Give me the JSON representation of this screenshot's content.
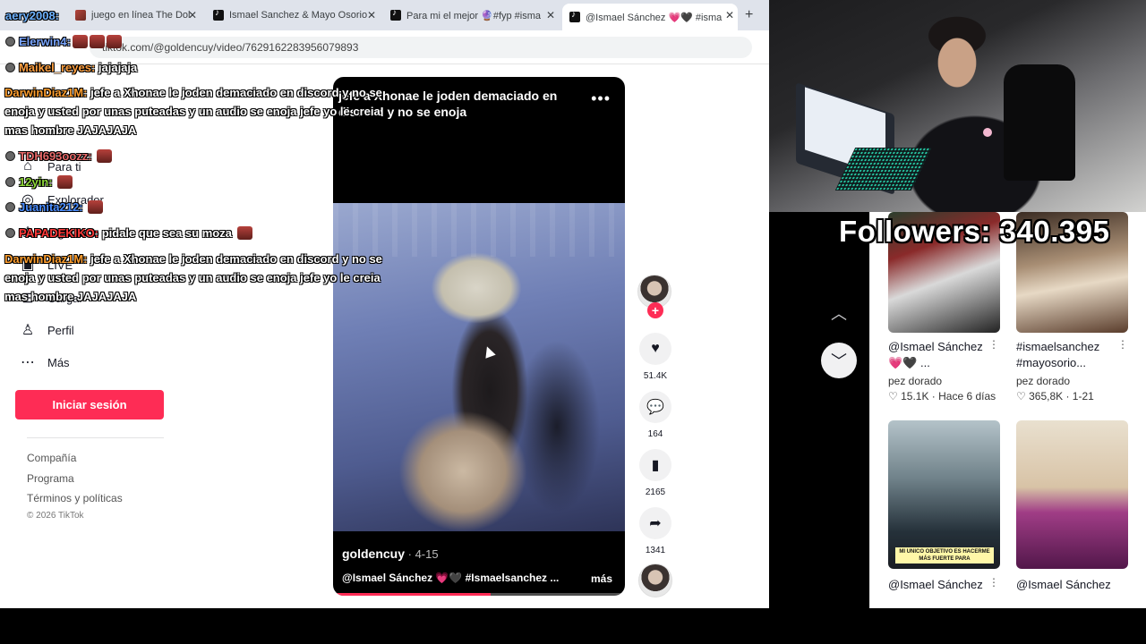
{
  "browser": {
    "tabs": [
      {
        "title": "juego en línea The Dol",
        "icon": "image-favicon"
      },
      {
        "title": "Ismael Sanchez & Mayo Osorio",
        "icon": "tiktok-favicon"
      },
      {
        "title": "Para mi el mejor 🔮#fyp #isma",
        "icon": "tiktok-favicon"
      },
      {
        "title": "@Ismael Sánchez 💗🖤 #isma",
        "icon": "tiktok-favicon",
        "active": true
      }
    ],
    "url": "tiktok.com/@goldencuy/video/7629162283956079893"
  },
  "sidebar": {
    "items": [
      {
        "label": "Para ti",
        "icon": "home-icon"
      },
      {
        "label": "Explorador",
        "icon": "compass-icon"
      },
      {
        "label": "Siguiendo",
        "icon": "following-icon"
      },
      {
        "label": "LIVE",
        "icon": "live-icon"
      },
      {
        "label": "Cargar",
        "icon": "upload-icon"
      },
      {
        "label": "Perfil",
        "icon": "profile-icon"
      },
      {
        "label": "Más",
        "icon": "more-icon"
      }
    ],
    "login": "Iniciar sesión",
    "footer_links": [
      "Compañía",
      "Programa",
      "Términos y políticas"
    ],
    "copyright": "© 2026 TikTok"
  },
  "video": {
    "caption": "jefe a Xhonae le joden demaciado en discord y no se enoja",
    "menu": "•••",
    "author": "goldencuy",
    "date": " · 4-15",
    "description": "@Ismael Sánchez 💗🖤 #Ismaelsanchez ...",
    "more": "más",
    "progress": 0.54
  },
  "actions": {
    "likes": "51.4K",
    "comments": "164",
    "saves": "2165",
    "shares": "1341"
  },
  "recommendations": [
    {
      "title_line1": "@Ismael Sánchez",
      "title_line2": "💗🖤 ...",
      "sub": "pez dorado",
      "meta": "♡ 15.1K · Hace 6 días"
    },
    {
      "title_line1": "#ismaelsanchez",
      "title_line2": "#mayosorio...",
      "sub": "pez dorado",
      "meta": "♡ 365,8K · 1-21"
    },
    {
      "title_line1": "@Ismael Sánchez",
      "thumb_caption": "MI UNICO OBJETIVO ES HACERME MÁS FUERTE PARA"
    },
    {
      "title_line1": "@Ismael Sánchez"
    }
  ],
  "stream": {
    "followers": "Followers: 340.395",
    "chat": [
      {
        "user": "aery2008:",
        "color": "#6fb3ff",
        "msg": ""
      },
      {
        "user": "Elerwin4:",
        "color": "#7aa6ff",
        "msg": ""
      },
      {
        "user": "Maikel_reyes:",
        "color": "#ffa040",
        "msg": "jajajaja"
      },
      {
        "user": "DarwinDiaz1M:",
        "color": "#ff9f2f",
        "msg": "jefe a Xhonae le joden demaciado en discord y no se enoja y usted por unas puteadas y un audio se enoja jefe yo le creia mas hombre JAJAJAJA"
      },
      {
        "user": "TDH693oozz:",
        "color": "#e86a6a",
        "msg": ""
      },
      {
        "user": "12yin:",
        "color": "#8fd93a",
        "msg": ""
      },
      {
        "user": "Juanita212:",
        "color": "#4a8dff",
        "msg": ""
      },
      {
        "user": "PAPADEKIKO:",
        "color": "#ff3a3a",
        "msg": "pidale que sea su moza"
      },
      {
        "user": "DarwinDiaz1M:",
        "color": "#ff9f2f",
        "msg": "jefe a Xhonae le joden demaciado en discord y no se enoja y usted por unas puteadas y un audio se enoja jefe yo le creia mas hombre JAJAJAJA"
      }
    ]
  },
  "colors": {
    "accent": "#fe2c55"
  }
}
